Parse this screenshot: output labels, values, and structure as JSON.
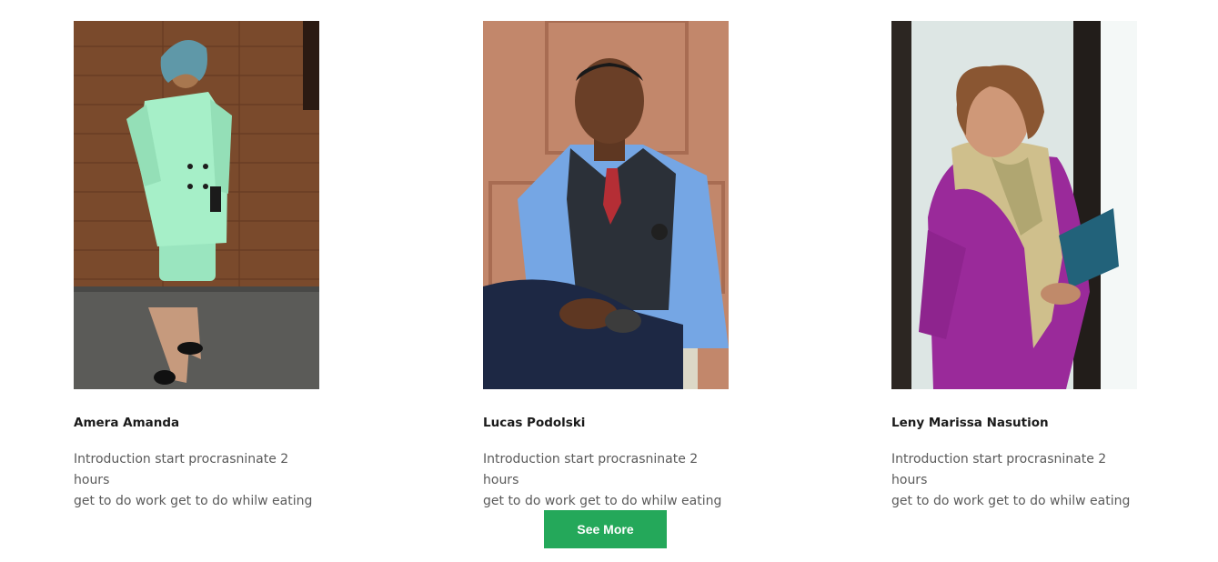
{
  "team": [
    {
      "name": "Amera Amanda",
      "description_line1": "Introduction start procrasninate 2 hours",
      "description_line2": "get to do work get to do whilw eating"
    },
    {
      "name": "Lucas Podolski",
      "description_line1": "Introduction start procrasninate 2 hours",
      "description_line2": "get to do work get to do whilw eating"
    },
    {
      "name": "Leny Marissa Nasution",
      "description_line1": "Introduction start procrasninate 2 hours",
      "description_line2": "get to do work get to do whilw eating"
    }
  ],
  "actions": {
    "see_more_label": "See More"
  },
  "colors": {
    "button": "#24a85a",
    "name_text": "#1a1a1a",
    "description_text": "#5a5a5a"
  }
}
